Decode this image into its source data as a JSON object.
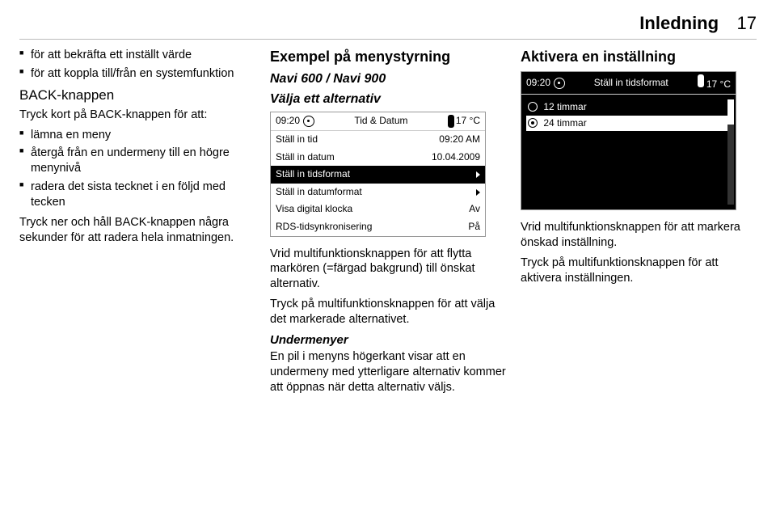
{
  "header": {
    "title": "Inledning",
    "page_number": "17"
  },
  "col1": {
    "bullets_top": [
      "för att bekräfta ett inställt värde",
      "för att koppla till/från en system­funktion"
    ],
    "back_heading": "BACK-knappen",
    "back_short_intro": "Tryck kort på BACK-knappen för att:",
    "back_short_bullets": [
      "lämna en meny",
      "återgå från en undermeny till en högre menynivå",
      "radera det sista tecknet i en följd med tecken"
    ],
    "back_hold": "Tryck ner och håll BACK-knappen några sekunder för att radera hela in­matningen."
  },
  "col2": {
    "heading": "Exempel på menystyrning",
    "sub1": "Navi 600 / Navi 900",
    "sub2": "Välja ett alternativ",
    "screen": {
      "time": "09:20",
      "title": "Tid & Datum",
      "temp": "17 °C",
      "rows": [
        {
          "label": "Ställ in tid",
          "value": "09:20 AM"
        },
        {
          "label": "Ställ in datum",
          "value": "10.04.2009"
        },
        {
          "label": "Ställ in tidsformat",
          "arrow": true,
          "selected": true
        },
        {
          "label": "Ställ in datumformat",
          "arrow": true
        },
        {
          "label": "Visa digital klocka",
          "value": "Av"
        },
        {
          "label": "RDS-tidsynkronisering",
          "value": "På"
        }
      ]
    },
    "p1": "Vrid multifunktionsknappen för att flytta markören (=färgad bakgrund) till önskat alternativ.",
    "p2": "Tryck på multifunktionsknappen för att välja det markerade alternativet.",
    "sub3": "Undermenyer",
    "p3": "En pil i menyns högerkant visar att en undermeny med ytterligare alternativ kommer att öppnas när detta alterna­tiv väljs."
  },
  "col3": {
    "heading": "Aktivera en inställning",
    "screen": {
      "time": "09:20",
      "title": "Ställ in tidsformat",
      "temp": "17 °C",
      "options": [
        {
          "label": "12 timmar",
          "checked": false,
          "selected": false
        },
        {
          "label": "24 timmar",
          "checked": true,
          "selected": true
        }
      ]
    },
    "p1": "Vrid multifunktionsknappen för att markera önskad inställning.",
    "p2": "Tryck på multifunktionsknappen för att aktivera inställningen."
  }
}
